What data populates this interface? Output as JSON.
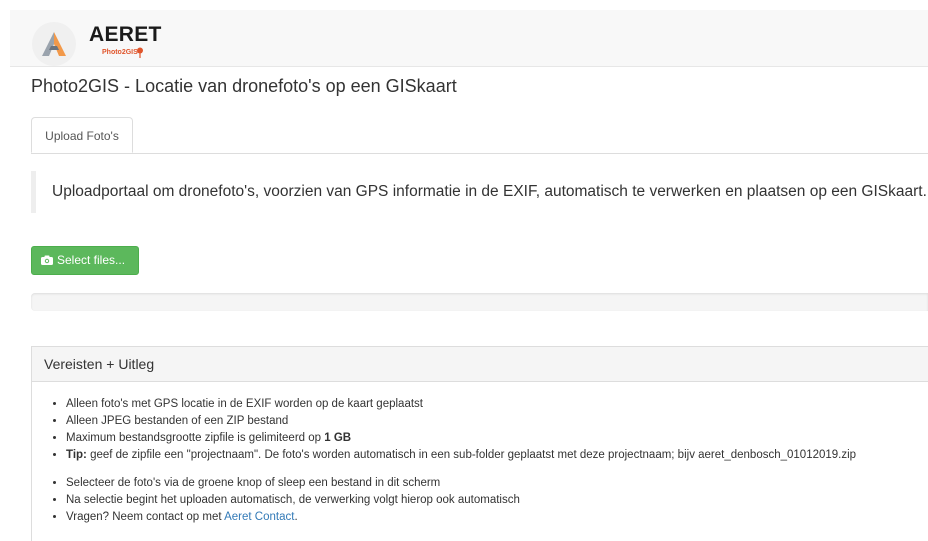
{
  "navbar": {
    "brand_name": "AERET",
    "brand_sub": "Photo2GIS",
    "accent_color": "#e0552b"
  },
  "page": {
    "title": "Photo2GIS - Locatie van dronefoto's op een GISkaart"
  },
  "tabs": [
    {
      "label": "Upload Foto's",
      "active": true
    }
  ],
  "intro": "Uploadportaal om dronefoto's, voorzien van GPS informatie in de EXIF, automatisch te verwerken en plaatsen op een GISkaart.",
  "upload": {
    "button_label": "Select files...",
    "button_icon": "camera-icon",
    "button_color": "#5cb85c",
    "progress_percent": 0
  },
  "panel": {
    "heading": "Vereisten + Uitleg",
    "list1": [
      {
        "text": "Alleen foto's met GPS locatie in de EXIF worden op de kaart geplaatst"
      },
      {
        "text": "Alleen JPEG bestanden of een ZIP bestand"
      },
      {
        "text_before": "Maximum bestandsgrootte zipfile is gelimiteerd op ",
        "bold": "1 GB"
      },
      {
        "bold_prefix": "Tip:",
        "text": " geef de zipfile een \"projectnaam\". De foto's worden automatisch in een sub-folder geplaatst met deze projectnaam; bijv aeret_denbosch_01012019.zip"
      }
    ],
    "list2": [
      {
        "text": "Selecteer de foto's via de groene knop of sleep een bestand in dit scherm"
      },
      {
        "text": "Na selectie begint het uploaden automatisch, de verwerking volgt hierop ook automatisch"
      },
      {
        "text_before": "Vragen? Neem contact op met ",
        "link": "Aeret Contact",
        "text_after": "."
      }
    ]
  }
}
